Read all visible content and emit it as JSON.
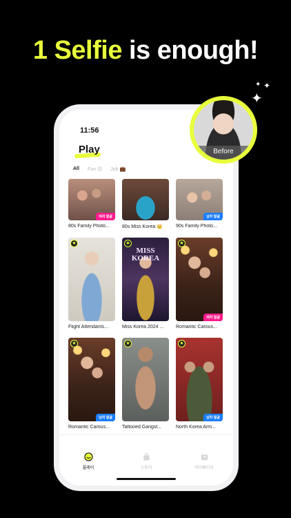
{
  "headline": {
    "accent": "1 Selfie",
    "rest": " is enough!"
  },
  "phone": {
    "status_time": "11:56",
    "title": "Play",
    "tabs": [
      {
        "label": "All",
        "active": true
      },
      {
        "label": "Fun 😊",
        "active": false
      },
      {
        "label": "Job 💼",
        "active": false
      }
    ],
    "cards": [
      {
        "caption": "80s Family Photo...",
        "badge": "여자 얼굴",
        "badge_color": "#ff1b8d",
        "starred": false
      },
      {
        "caption": "80s Miss Korea 👑",
        "badge": "",
        "badge_color": "",
        "starred": false
      },
      {
        "caption": "90s Family Photo...",
        "badge": "남자 얼굴",
        "badge_color": "#1a7dff",
        "starred": false
      },
      {
        "caption": "Flight Attendants...",
        "badge": "",
        "badge_color": "",
        "starred": true
      },
      {
        "caption": "Miss Korea 2024 ...",
        "badge": "",
        "badge_color": "",
        "starred": true,
        "overlay_text": "MISS KOREA"
      },
      {
        "caption": "Romantic Carous...",
        "badge": "여자 얼굴",
        "badge_color": "#ff1b8d",
        "starred": true
      },
      {
        "caption": "Romantic Carous...",
        "badge": "남자 얼굴",
        "badge_color": "#1a7dff",
        "starred": true
      },
      {
        "caption": "Tattooed Gangst...",
        "badge": "",
        "badge_color": "",
        "starred": true
      },
      {
        "caption": "North Korea Arm...",
        "badge": "남자 얼굴",
        "badge_color": "#1a7dff",
        "starred": true
      }
    ],
    "nav": [
      {
        "label": "플레이",
        "icon": "play-face-icon",
        "active": true
      },
      {
        "label": "스토어",
        "icon": "shopping-bag-icon",
        "active": false
      },
      {
        "label": "마이페이지",
        "icon": "wallet-icon",
        "active": false
      }
    ]
  },
  "before_avatar": {
    "label": "Before"
  },
  "colors": {
    "accent": "#e8ff3c",
    "background": "#000000",
    "pink_badge": "#ff1b8d",
    "blue_badge": "#1a7dff"
  }
}
